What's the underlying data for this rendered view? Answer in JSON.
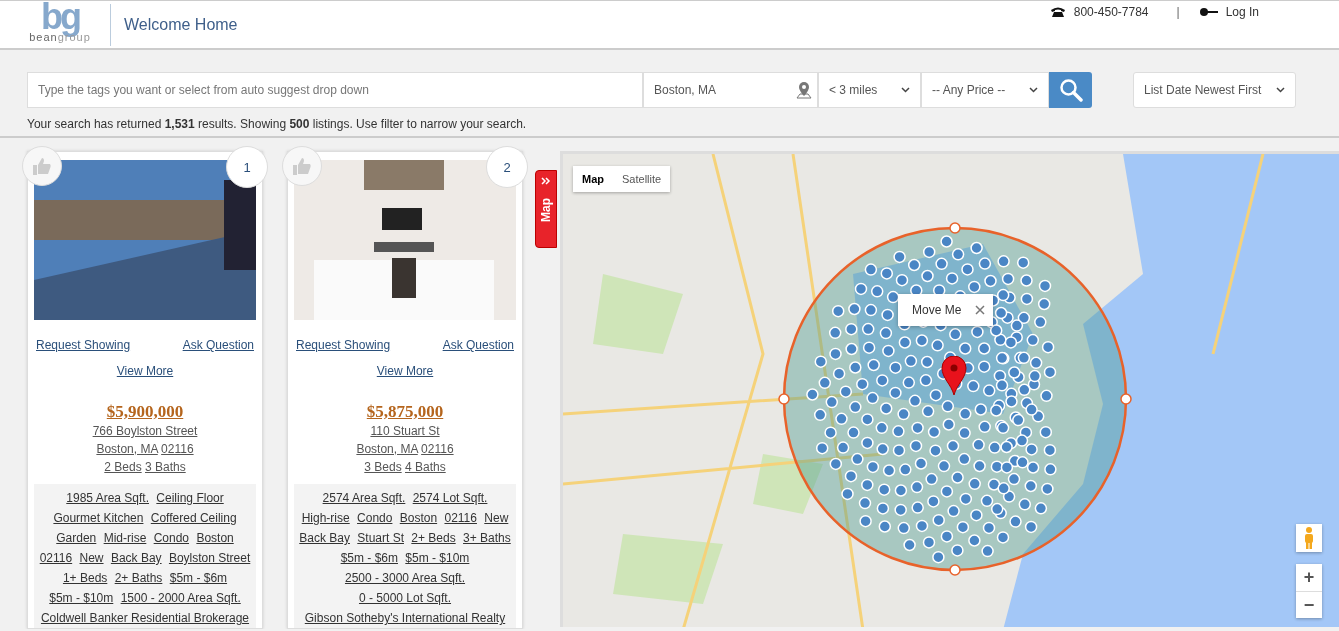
{
  "header": {
    "logo": {
      "mark": "bg",
      "wordmark_primary": "bean",
      "wordmark_secondary": "group"
    },
    "title": "Welcome Home",
    "phone": "800-450-7784",
    "separator": "|",
    "login": "Log In"
  },
  "search": {
    "placeholder": "Type the tags you want or select from auto suggest drop down",
    "location": "Boston, MA",
    "radius": "< 3 miles",
    "price": "-- Any Price --",
    "sort": "List Date Newest First",
    "summary": "Your search has returned **1,531** results. Showing **500** listings. Use filter to narrow your search."
  },
  "listings": [
    {
      "number": "1",
      "request": "Request Showing",
      "ask": "Ask Question",
      "view_more": "View More",
      "price": "$5,900,000",
      "street": "766 Boylston Street",
      "city": "Boston, MA",
      "zip": "02116",
      "beds": "2 Beds",
      "baths": "3 Baths",
      "tags": [
        "1985 Area Sqft.",
        "Ceiling Floor",
        "Gourmet Kitchen",
        "Coffered Ceiling",
        "Garden",
        "Mid-rise",
        "Condo",
        "Boston",
        "02116",
        "New",
        "Back Bay",
        "Boylston Street",
        "1+ Beds",
        "2+ Baths",
        "$5m - $6m",
        "$5m - $10m",
        "1500 - 2000 Area Sqft."
      ],
      "agency": "Coldwell Banker Residential Brokerage"
    },
    {
      "number": "2",
      "request": "Request Showing",
      "ask": "Ask Question",
      "view_more": "View More",
      "price": "$5,875,000",
      "street": "110 Stuart St",
      "city": "Boston, MA",
      "zip": "02116",
      "beds": "3 Beds",
      "baths": "4 Baths",
      "tags": [
        "2574 Area Sqft.",
        "2574 Lot Sqft.",
        "High-rise",
        "Condo",
        "Boston",
        "02116",
        "New",
        "Back Bay",
        "Stuart St",
        "2+ Beds",
        "3+ Baths",
        "$5m - $6m",
        "$5m - $10m",
        "2500 - 3000 Area Sqft.",
        "0 - 5000 Lot Sqft."
      ],
      "agency": "Gibson Sotheby's International Realty"
    }
  ],
  "map_tab": {
    "label": "Map"
  },
  "map": {
    "type_buttons": [
      {
        "label": "Map",
        "selected": true
      },
      {
        "label": "Satellite",
        "selected": false
      }
    ],
    "popup": "Move Me",
    "zoom_in": "+",
    "zoom_out": "−"
  }
}
